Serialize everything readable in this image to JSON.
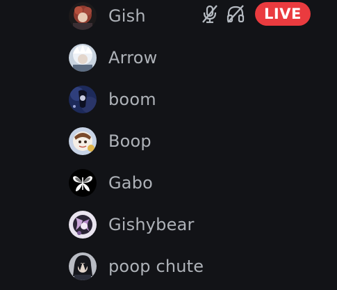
{
  "members": [
    {
      "name": "Gish",
      "avatar": "avatar-gish"
    },
    {
      "name": "Arrow",
      "avatar": "avatar-arrow"
    },
    {
      "name": "boom",
      "avatar": "avatar-boom"
    },
    {
      "name": "Boop",
      "avatar": "avatar-boop"
    },
    {
      "name": "Gabo",
      "avatar": "avatar-gabo"
    },
    {
      "name": "Gishybear",
      "avatar": "avatar-gishybear"
    },
    {
      "name": "poop chute",
      "avatar": "avatar-poop-chute"
    }
  ],
  "status": {
    "muted_icon": "microphone-muted-icon",
    "deafened_icon": "headphones-deafened-icon",
    "live_label": "LIVE",
    "live_color": "#ea3b3f"
  },
  "colors": {
    "background": "#121317",
    "name_text": "#aeb2b8",
    "status_icon": "#b5bac1"
  }
}
